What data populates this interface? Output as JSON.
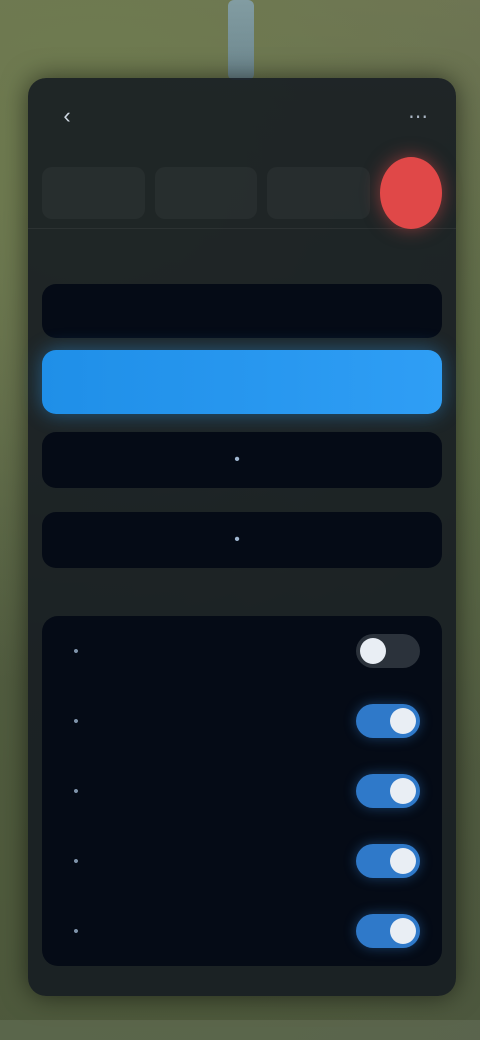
{
  "header": {
    "title": "",
    "subtitle": "",
    "stats": [
      {
        "value": "",
        "label": ""
      },
      {
        "value": "",
        "label": ""
      },
      {
        "value": "",
        "label": ""
      }
    ],
    "stop_label": ""
  },
  "actions": {
    "primary_label": "",
    "secondary_label": "",
    "tertiary_label": "",
    "quaternary_label": ""
  },
  "settings": {
    "section_title": "",
    "items": [
      {
        "label": "",
        "enabled": false
      },
      {
        "label": "",
        "enabled": true
      },
      {
        "label": "",
        "enabled": true
      },
      {
        "label": "",
        "enabled": true
      },
      {
        "label": "",
        "enabled": true
      }
    ]
  },
  "colors": {
    "accent": "#2f9ef5",
    "stop": "#e04848",
    "toggle_on": "#2f79c9",
    "toggle_off": "#2b323b"
  },
  "icons": {
    "back": "chevron-left-icon",
    "more": "more-icon",
    "item": "dot-icon"
  }
}
